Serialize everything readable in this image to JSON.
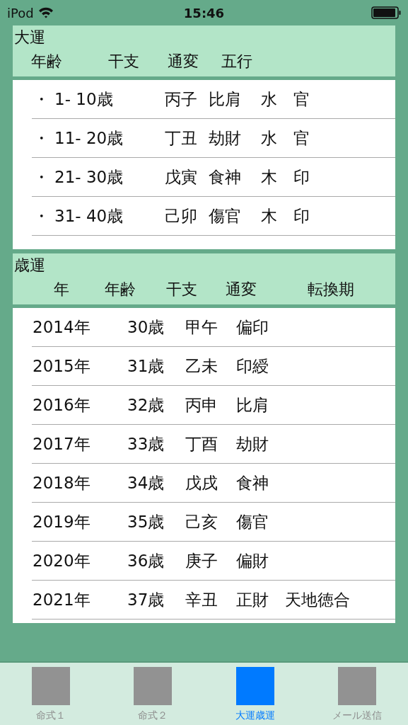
{
  "status_bar": {
    "carrier": "iPod",
    "time": "15:46"
  },
  "daiun": {
    "title": "大運",
    "columns": [
      "年齢",
      "干支",
      "通変",
      "五行"
    ],
    "rows": [
      {
        "bullet": "・",
        "age": "1- 10歳",
        "kanshi": "丙子",
        "tsuhen": "比肩",
        "gogyo": "水",
        "un": "官"
      },
      {
        "bullet": "・",
        "age": "11- 20歳",
        "kanshi": "丁丑",
        "tsuhen": "劫財",
        "gogyo": "水",
        "un": "官"
      },
      {
        "bullet": "・",
        "age": "21- 30歳",
        "kanshi": "戊寅",
        "tsuhen": "食神",
        "gogyo": "木",
        "un": "印"
      },
      {
        "bullet": "・",
        "age": "31- 40歳",
        "kanshi": "己卯",
        "tsuhen": "傷官",
        "gogyo": "木",
        "un": "印"
      }
    ]
  },
  "saiun": {
    "title": "歳運",
    "columns": [
      "年",
      "年齢",
      "干支",
      "通変",
      "転換期"
    ],
    "rows": [
      {
        "year": "2014年",
        "age": "30歳",
        "kanshi": "甲午",
        "tsuhen": "偏印"
      },
      {
        "year": "2015年",
        "age": "31歳",
        "kanshi": "乙未",
        "tsuhen": "印綬"
      },
      {
        "year": "2016年",
        "age": "32歳",
        "kanshi": "丙申",
        "tsuhen": "比肩"
      },
      {
        "year": "2017年",
        "age": "33歳",
        "kanshi": "丁酉",
        "tsuhen": "劫財"
      },
      {
        "year": "2018年",
        "age": "34歳",
        "kanshi": "戊戌",
        "tsuhen": "食神"
      },
      {
        "year": "2019年",
        "age": "35歳",
        "kanshi": "己亥",
        "tsuhen": "傷官"
      },
      {
        "year": "2020年",
        "age": "36歳",
        "kanshi": "庚子",
        "tsuhen": "偏財"
      },
      {
        "year": "2021年",
        "age": "37歳",
        "kanshi": "辛丑",
        "tsuhen": "正財",
        "tenkan": "天地徳合"
      }
    ]
  },
  "tabs": [
    {
      "label": "命式１",
      "selected": false
    },
    {
      "label": "命式２",
      "selected": false
    },
    {
      "label": "大運歳運",
      "selected": true
    },
    {
      "label": "メール送信",
      "selected": false
    }
  ]
}
